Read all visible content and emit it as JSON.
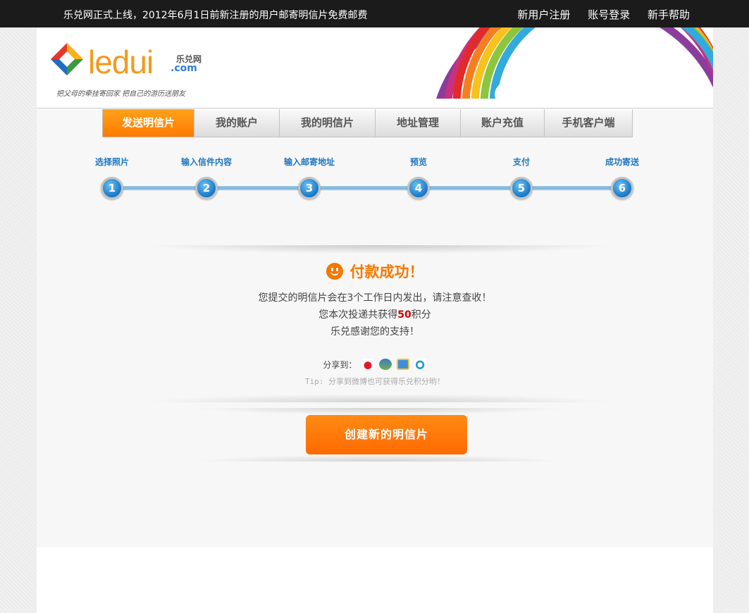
{
  "topbar": {
    "notice": "乐兑网正式上线，2012年6月1日前新注册的用户邮寄明信片免费邮费",
    "links": [
      "新用户注册",
      "账号登录",
      "新手帮助"
    ]
  },
  "header": {
    "logo_text": "ledui",
    "logo_cn": "乐兑网",
    "logo_com": ".com",
    "slogan": "把父母的牵挂寄回家  把自己的游历送朋友"
  },
  "nav": {
    "tabs": [
      "发送明信片",
      "我的账户",
      "我的明信片",
      "地址管理",
      "账户充值",
      "手机客户端"
    ],
    "active": 0
  },
  "steps": [
    {
      "label": "选择照片",
      "num": "1"
    },
    {
      "label": "输入信件内容",
      "num": "2"
    },
    {
      "label": "输入邮寄地址",
      "num": "3"
    },
    {
      "label": "预览",
      "num": "4"
    },
    {
      "label": "支付",
      "num": "5"
    },
    {
      "label": "成功寄送",
      "num": "6"
    }
  ],
  "success": {
    "title": "付款成功！",
    "line1": "您提交的明信片会在3个工作日内发出，请注意查收！",
    "line2_prefix": "您本次投递共获得",
    "points": "50",
    "line2_suffix": "积分",
    "line3": "乐兑感谢您的支持！"
  },
  "share": {
    "label": "分享到：",
    "icons": [
      "weibo-icon",
      "renren-icon",
      "qzone-icon",
      "tencent-weibo-icon"
    ],
    "tip": "Tip: 分享到微博也可获得乐兑积分哟！"
  },
  "create_button": "创建新的明信片",
  "colors": {
    "accent": "#f57800",
    "step_blue": "#1d77c2",
    "topbar": "#1b1b1b"
  }
}
